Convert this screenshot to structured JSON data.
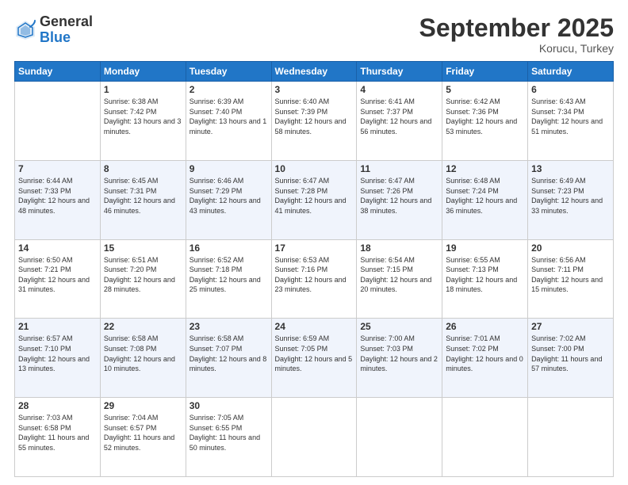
{
  "header": {
    "logo_general": "General",
    "logo_blue": "Blue",
    "month_title": "September 2025",
    "location": "Korucu, Turkey"
  },
  "weekdays": [
    "Sunday",
    "Monday",
    "Tuesday",
    "Wednesday",
    "Thursday",
    "Friday",
    "Saturday"
  ],
  "weeks": [
    [
      {
        "day": "",
        "sunrise": "",
        "sunset": "",
        "daylight": ""
      },
      {
        "day": "1",
        "sunrise": "Sunrise: 6:38 AM",
        "sunset": "Sunset: 7:42 PM",
        "daylight": "Daylight: 13 hours and 3 minutes."
      },
      {
        "day": "2",
        "sunrise": "Sunrise: 6:39 AM",
        "sunset": "Sunset: 7:40 PM",
        "daylight": "Daylight: 13 hours and 1 minute."
      },
      {
        "day": "3",
        "sunrise": "Sunrise: 6:40 AM",
        "sunset": "Sunset: 7:39 PM",
        "daylight": "Daylight: 12 hours and 58 minutes."
      },
      {
        "day": "4",
        "sunrise": "Sunrise: 6:41 AM",
        "sunset": "Sunset: 7:37 PM",
        "daylight": "Daylight: 12 hours and 56 minutes."
      },
      {
        "day": "5",
        "sunrise": "Sunrise: 6:42 AM",
        "sunset": "Sunset: 7:36 PM",
        "daylight": "Daylight: 12 hours and 53 minutes."
      },
      {
        "day": "6",
        "sunrise": "Sunrise: 6:43 AM",
        "sunset": "Sunset: 7:34 PM",
        "daylight": "Daylight: 12 hours and 51 minutes."
      }
    ],
    [
      {
        "day": "7",
        "sunrise": "Sunrise: 6:44 AM",
        "sunset": "Sunset: 7:33 PM",
        "daylight": "Daylight: 12 hours and 48 minutes."
      },
      {
        "day": "8",
        "sunrise": "Sunrise: 6:45 AM",
        "sunset": "Sunset: 7:31 PM",
        "daylight": "Daylight: 12 hours and 46 minutes."
      },
      {
        "day": "9",
        "sunrise": "Sunrise: 6:46 AM",
        "sunset": "Sunset: 7:29 PM",
        "daylight": "Daylight: 12 hours and 43 minutes."
      },
      {
        "day": "10",
        "sunrise": "Sunrise: 6:47 AM",
        "sunset": "Sunset: 7:28 PM",
        "daylight": "Daylight: 12 hours and 41 minutes."
      },
      {
        "day": "11",
        "sunrise": "Sunrise: 6:47 AM",
        "sunset": "Sunset: 7:26 PM",
        "daylight": "Daylight: 12 hours and 38 minutes."
      },
      {
        "day": "12",
        "sunrise": "Sunrise: 6:48 AM",
        "sunset": "Sunset: 7:24 PM",
        "daylight": "Daylight: 12 hours and 36 minutes."
      },
      {
        "day": "13",
        "sunrise": "Sunrise: 6:49 AM",
        "sunset": "Sunset: 7:23 PM",
        "daylight": "Daylight: 12 hours and 33 minutes."
      }
    ],
    [
      {
        "day": "14",
        "sunrise": "Sunrise: 6:50 AM",
        "sunset": "Sunset: 7:21 PM",
        "daylight": "Daylight: 12 hours and 31 minutes."
      },
      {
        "day": "15",
        "sunrise": "Sunrise: 6:51 AM",
        "sunset": "Sunset: 7:20 PM",
        "daylight": "Daylight: 12 hours and 28 minutes."
      },
      {
        "day": "16",
        "sunrise": "Sunrise: 6:52 AM",
        "sunset": "Sunset: 7:18 PM",
        "daylight": "Daylight: 12 hours and 25 minutes."
      },
      {
        "day": "17",
        "sunrise": "Sunrise: 6:53 AM",
        "sunset": "Sunset: 7:16 PM",
        "daylight": "Daylight: 12 hours and 23 minutes."
      },
      {
        "day": "18",
        "sunrise": "Sunrise: 6:54 AM",
        "sunset": "Sunset: 7:15 PM",
        "daylight": "Daylight: 12 hours and 20 minutes."
      },
      {
        "day": "19",
        "sunrise": "Sunrise: 6:55 AM",
        "sunset": "Sunset: 7:13 PM",
        "daylight": "Daylight: 12 hours and 18 minutes."
      },
      {
        "day": "20",
        "sunrise": "Sunrise: 6:56 AM",
        "sunset": "Sunset: 7:11 PM",
        "daylight": "Daylight: 12 hours and 15 minutes."
      }
    ],
    [
      {
        "day": "21",
        "sunrise": "Sunrise: 6:57 AM",
        "sunset": "Sunset: 7:10 PM",
        "daylight": "Daylight: 12 hours and 13 minutes."
      },
      {
        "day": "22",
        "sunrise": "Sunrise: 6:58 AM",
        "sunset": "Sunset: 7:08 PM",
        "daylight": "Daylight: 12 hours and 10 minutes."
      },
      {
        "day": "23",
        "sunrise": "Sunrise: 6:58 AM",
        "sunset": "Sunset: 7:07 PM",
        "daylight": "Daylight: 12 hours and 8 minutes."
      },
      {
        "day": "24",
        "sunrise": "Sunrise: 6:59 AM",
        "sunset": "Sunset: 7:05 PM",
        "daylight": "Daylight: 12 hours and 5 minutes."
      },
      {
        "day": "25",
        "sunrise": "Sunrise: 7:00 AM",
        "sunset": "Sunset: 7:03 PM",
        "daylight": "Daylight: 12 hours and 2 minutes."
      },
      {
        "day": "26",
        "sunrise": "Sunrise: 7:01 AM",
        "sunset": "Sunset: 7:02 PM",
        "daylight": "Daylight: 12 hours and 0 minutes."
      },
      {
        "day": "27",
        "sunrise": "Sunrise: 7:02 AM",
        "sunset": "Sunset: 7:00 PM",
        "daylight": "Daylight: 11 hours and 57 minutes."
      }
    ],
    [
      {
        "day": "28",
        "sunrise": "Sunrise: 7:03 AM",
        "sunset": "Sunset: 6:58 PM",
        "daylight": "Daylight: 11 hours and 55 minutes."
      },
      {
        "day": "29",
        "sunrise": "Sunrise: 7:04 AM",
        "sunset": "Sunset: 6:57 PM",
        "daylight": "Daylight: 11 hours and 52 minutes."
      },
      {
        "day": "30",
        "sunrise": "Sunrise: 7:05 AM",
        "sunset": "Sunset: 6:55 PM",
        "daylight": "Daylight: 11 hours and 50 minutes."
      },
      {
        "day": "",
        "sunrise": "",
        "sunset": "",
        "daylight": ""
      },
      {
        "day": "",
        "sunrise": "",
        "sunset": "",
        "daylight": ""
      },
      {
        "day": "",
        "sunrise": "",
        "sunset": "",
        "daylight": ""
      },
      {
        "day": "",
        "sunrise": "",
        "sunset": "",
        "daylight": ""
      }
    ]
  ]
}
